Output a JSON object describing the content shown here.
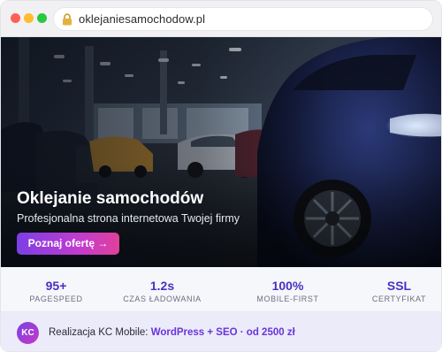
{
  "browser": {
    "url": "oklejaniesamochodow.pl"
  },
  "hero": {
    "title": "Oklejanie samochodów",
    "subtitle": "Profesjonalna strona internetowa Twojej firmy",
    "cta_label": "Poznaj ofertę →"
  },
  "stats": [
    {
      "value": "95+",
      "label": "PAGESPEED"
    },
    {
      "value": "1.2s",
      "label": "CZAS ŁADOWANIA"
    },
    {
      "value": "100%",
      "label": "MOBILE-FIRST"
    },
    {
      "value": "SSL",
      "label": "CERTYFIKAT"
    }
  ],
  "footer": {
    "avatar_initials": "KC",
    "prefix": "Realizacja KC Mobile: ",
    "highlight": "WordPress + SEO · od 2500 zł"
  },
  "colors": {
    "accent": "#4a2fc4",
    "cta_gradient_start": "#7b3fe4",
    "cta_gradient_end": "#e0409a",
    "footer_background": "#ecebfa"
  }
}
